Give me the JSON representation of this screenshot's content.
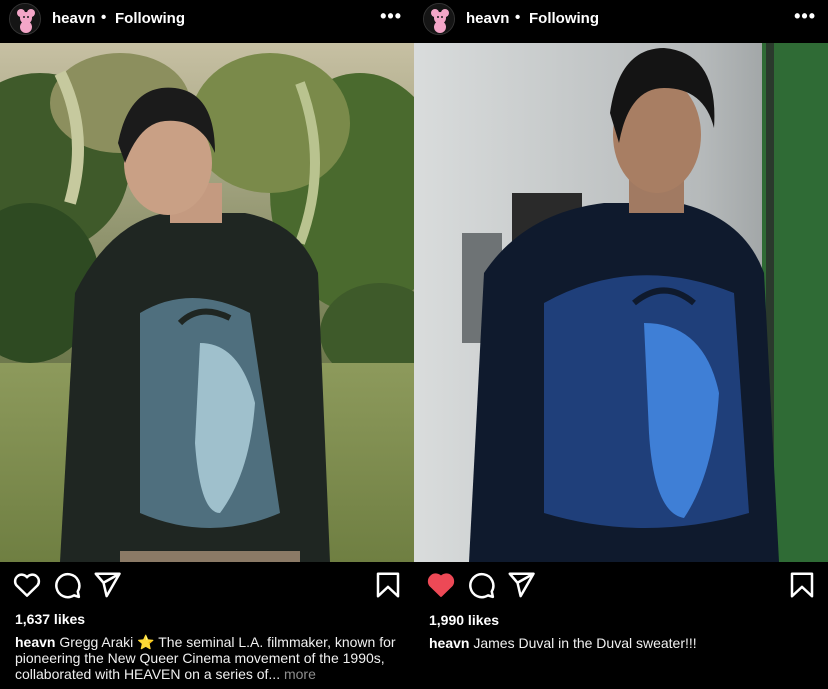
{
  "posts": [
    {
      "username": "heavn",
      "separator": "•",
      "follow_status": "Following",
      "more_icon": "more-horizontal-icon",
      "photo_subject": "man in dark sweater printed with a face, standing in a garden",
      "liked": false,
      "likes": "1,637 likes",
      "caption_user": "heavn",
      "caption_text": "Gregg Araki ⭐ The seminal L.A. filmmaker, known for pioneering the New Queer Cinema movement of the 1990s, collaborated with HEAVEN on a series of...",
      "caption_more": "more"
    },
    {
      "username": "heavn",
      "separator": "•",
      "follow_status": "Following",
      "more_icon": "more-horizontal-icon",
      "photo_subject": "man in dark sweater printed with a blue face, indoor studio",
      "liked": true,
      "likes": "1,990 likes",
      "caption_user": "heavn",
      "caption_text": "James Duval in the Duval sweater!!!",
      "caption_more": ""
    }
  ],
  "colors": {
    "background": "#000000",
    "text": "#f5f5f5",
    "muted": "#8e8e8e",
    "liked_heart": "#ed4956"
  }
}
